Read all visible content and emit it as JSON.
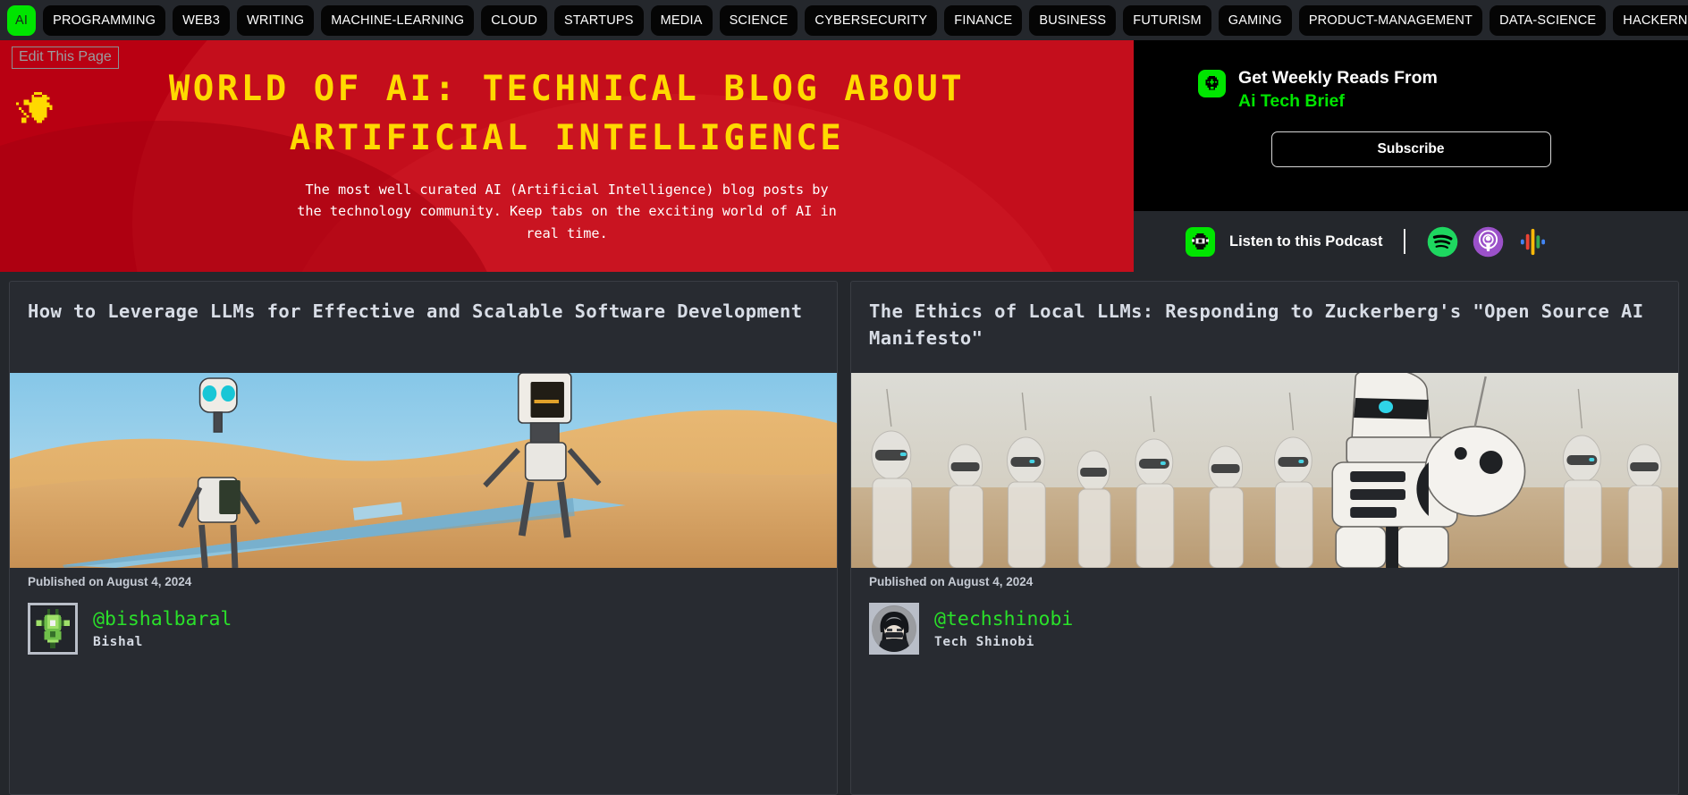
{
  "nav": {
    "brand": {
      "label": "AI",
      "color": "#00e500"
    },
    "items": [
      {
        "label": "PROGRAMMING"
      },
      {
        "label": "WEB3"
      },
      {
        "label": "WRITING"
      },
      {
        "label": "MACHINE-LEARNING"
      },
      {
        "label": "CLOUD"
      },
      {
        "label": "STARTUPS"
      },
      {
        "label": "MEDIA"
      },
      {
        "label": "SCIENCE"
      },
      {
        "label": "CYBERSECURITY"
      },
      {
        "label": "FINANCE"
      },
      {
        "label": "BUSINESS"
      },
      {
        "label": "FUTURISM"
      },
      {
        "label": "GAMING"
      },
      {
        "label": "PRODUCT-MANAGEMENT"
      },
      {
        "label": "DATA-SCIENCE"
      },
      {
        "label": "HACKERNOON"
      }
    ]
  },
  "hero": {
    "edit_label": "Edit This Page",
    "logo_icon": "pixel-brain-icon",
    "title": "World of AI: Technical Blog about Artificial Intelligence",
    "subtitle": "The most well curated AI (Artificial Intelligence) blog posts by the technology community. Keep tabs on the exciting world of AI in real time.",
    "bg_color": "#b90012",
    "title_color": "#ffd900"
  },
  "newsletter": {
    "badge_icon": "hackernoon-logo-icon",
    "heading": "Get Weekly Reads From",
    "name": "Ai Tech Brief",
    "subscribe_label": "Subscribe",
    "accent_color": "#00e500"
  },
  "podcast": {
    "badge_icon": "hackernoon-logo-icon",
    "label": "Listen to this Podcast",
    "platforms": [
      {
        "name": "spotify-icon",
        "color": "#1ed760"
      },
      {
        "name": "apple-podcasts-icon",
        "color": "#9b51c9"
      },
      {
        "name": "google-podcasts-icon",
        "color": "#fab908"
      }
    ]
  },
  "cards": [
    {
      "title": "How to Leverage LLMs for Effective and Scalable Software Development",
      "image_alt": "two humanoid robots walking on a blue steel beam in a desert",
      "date": "Published on August 4, 2024",
      "author_handle": "@bishalbaral",
      "author_name": "Bishal",
      "avatar_alt": "green pixel robot avatar"
    },
    {
      "title": "The Ethics of Local LLMs: Responding to Zuckerberg's \"Open Source AI Manifesto\"",
      "image_alt": "army of white humanoid robots marching in a desert",
      "date": "Published on August 4, 2024",
      "author_handle": "@techshinobi",
      "author_name": "Tech Shinobi",
      "avatar_alt": "anime ninja character avatar"
    }
  ]
}
